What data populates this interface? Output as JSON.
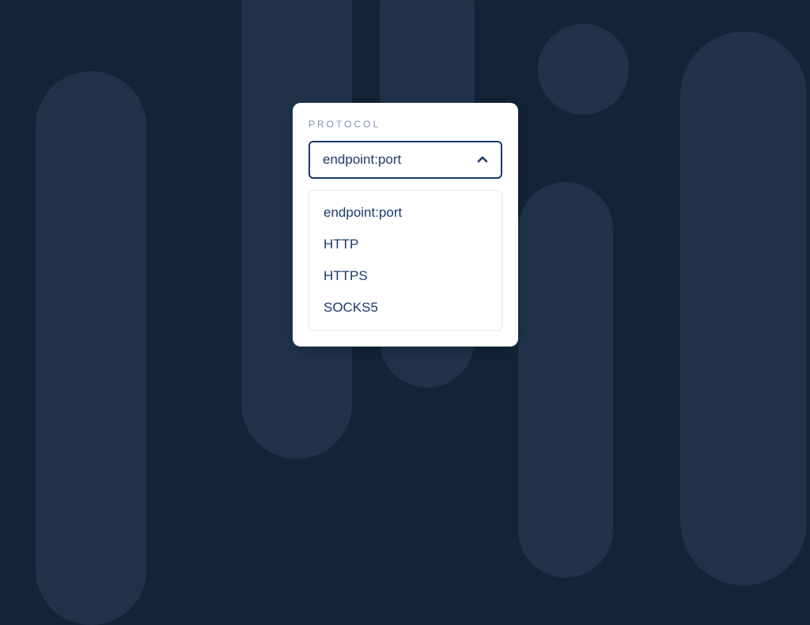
{
  "form": {
    "label": "PROTOCOL",
    "selected": "endpoint:port",
    "options": [
      "endpoint:port",
      "HTTP",
      "HTTPS",
      "SOCKS5"
    ]
  },
  "colors": {
    "bg": "#132438",
    "shape": "#203349",
    "card": "#ffffff",
    "label": "#8590b5",
    "accent": "#1a3a6e"
  }
}
